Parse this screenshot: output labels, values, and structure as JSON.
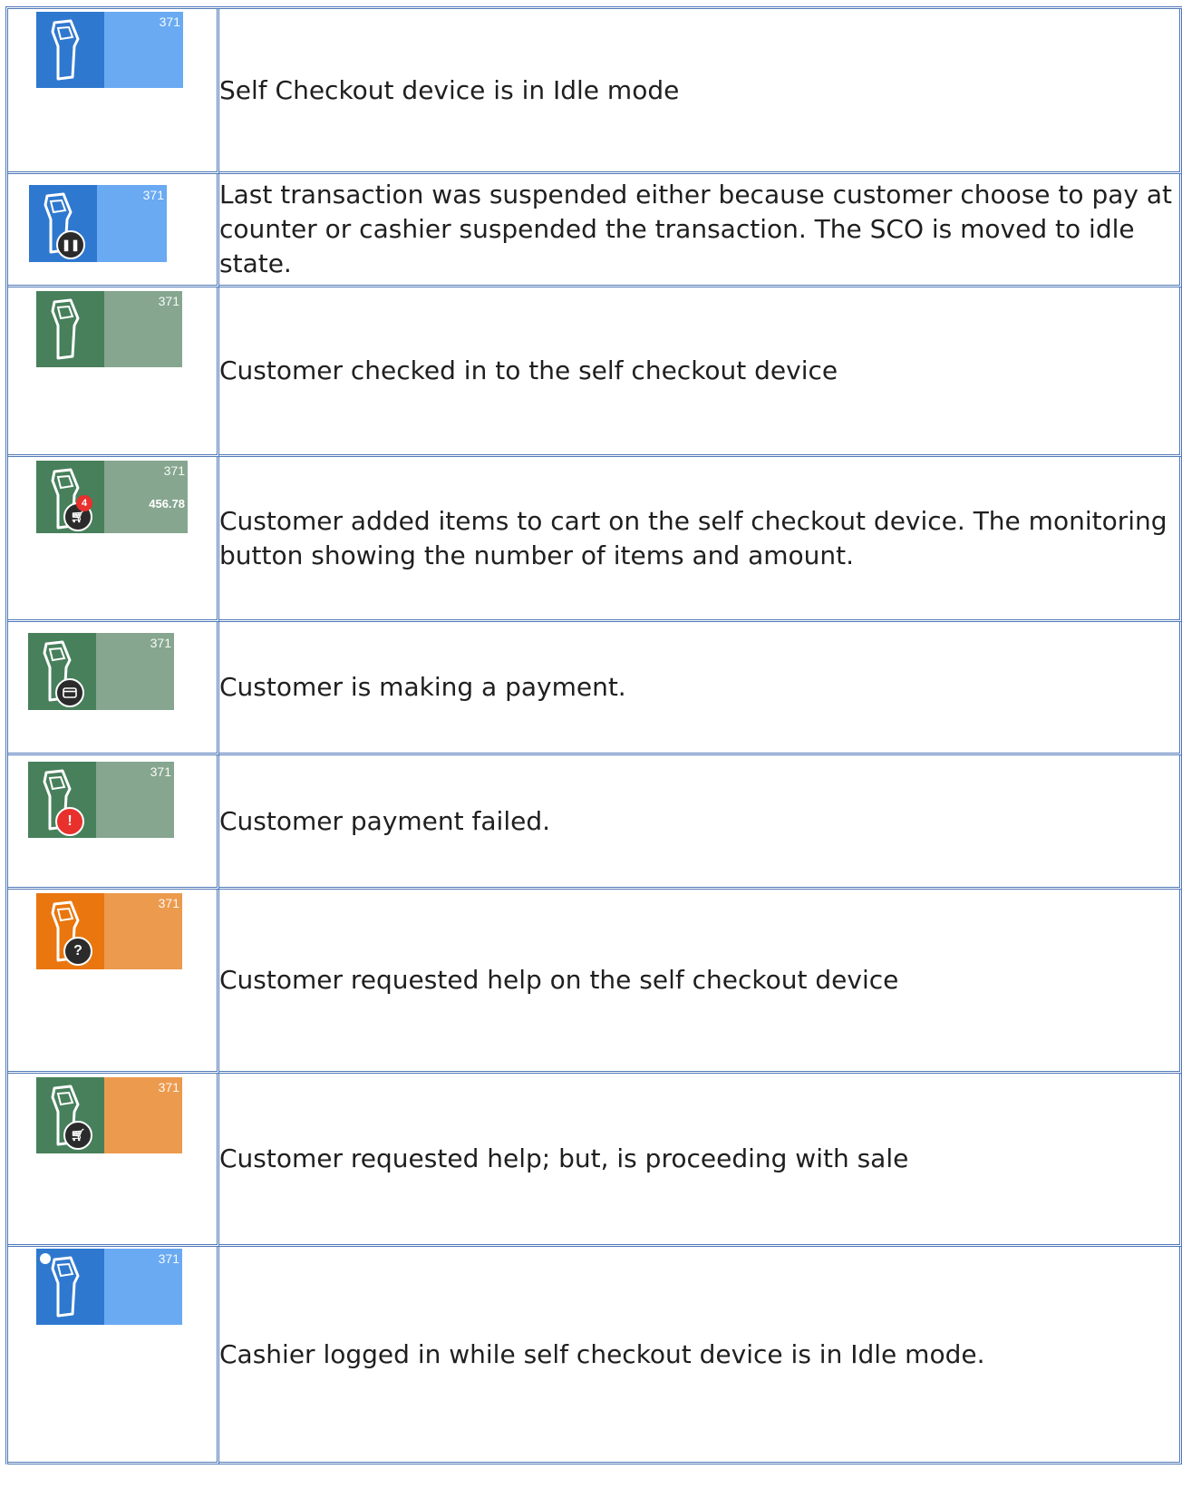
{
  "colors": {
    "blue_dark": "#2f78cf",
    "blue_light": "#6aaaf2",
    "green_dark": "#47805b",
    "green_light": "#86a68f",
    "orange_dark": "#e9760e",
    "orange_light": "#ec9a4d",
    "badge_dark": "#2b2b2b",
    "badge_red": "#e8302c",
    "border": "#4e77b7"
  },
  "rows": [
    {
      "tile": {
        "number": "371",
        "scheme": "blue",
        "overlay_icon": "none"
      },
      "description": "Self Checkout device is in Idle mode"
    },
    {
      "tile": {
        "number": "371",
        "scheme": "blue",
        "overlay_icon": "pause-icon"
      },
      "description": "Last transaction was suspended either because customer choose to pay at counter or cashier suspended the transaction. The SCO is moved to idle state."
    },
    {
      "tile": {
        "number": "371",
        "scheme": "green",
        "overlay_icon": "none"
      },
      "description": "Customer checked in to the self checkout device"
    },
    {
      "tile": {
        "number": "371",
        "amount": "456.78",
        "item_count": "4",
        "scheme": "green",
        "overlay_icon": "cart-icon"
      },
      "description": "Customer added items to cart on the self checkout device. The monitoring button showing the number of items and amount."
    },
    {
      "tile": {
        "number": "371",
        "scheme": "green",
        "overlay_icon": "card-icon"
      },
      "description": "Customer is making a payment."
    },
    {
      "tile": {
        "number": "371",
        "scheme": "green",
        "overlay_icon": "alert-icon"
      },
      "description": "Customer payment failed."
    },
    {
      "tile": {
        "number": "371",
        "scheme": "orange",
        "overlay_icon": "help-icon"
      },
      "description": "Customer requested help on the self checkout device"
    },
    {
      "tile": {
        "number": "371",
        "scheme": "green-orange",
        "overlay_icon": "cart-icon"
      },
      "description": "Customer requested help; but, is proceeding with sale"
    },
    {
      "tile": {
        "number": "371",
        "scheme": "blue",
        "overlay_icon": "status-dot-icon"
      },
      "description": "Cashier logged in while self checkout device is in Idle mode."
    }
  ]
}
